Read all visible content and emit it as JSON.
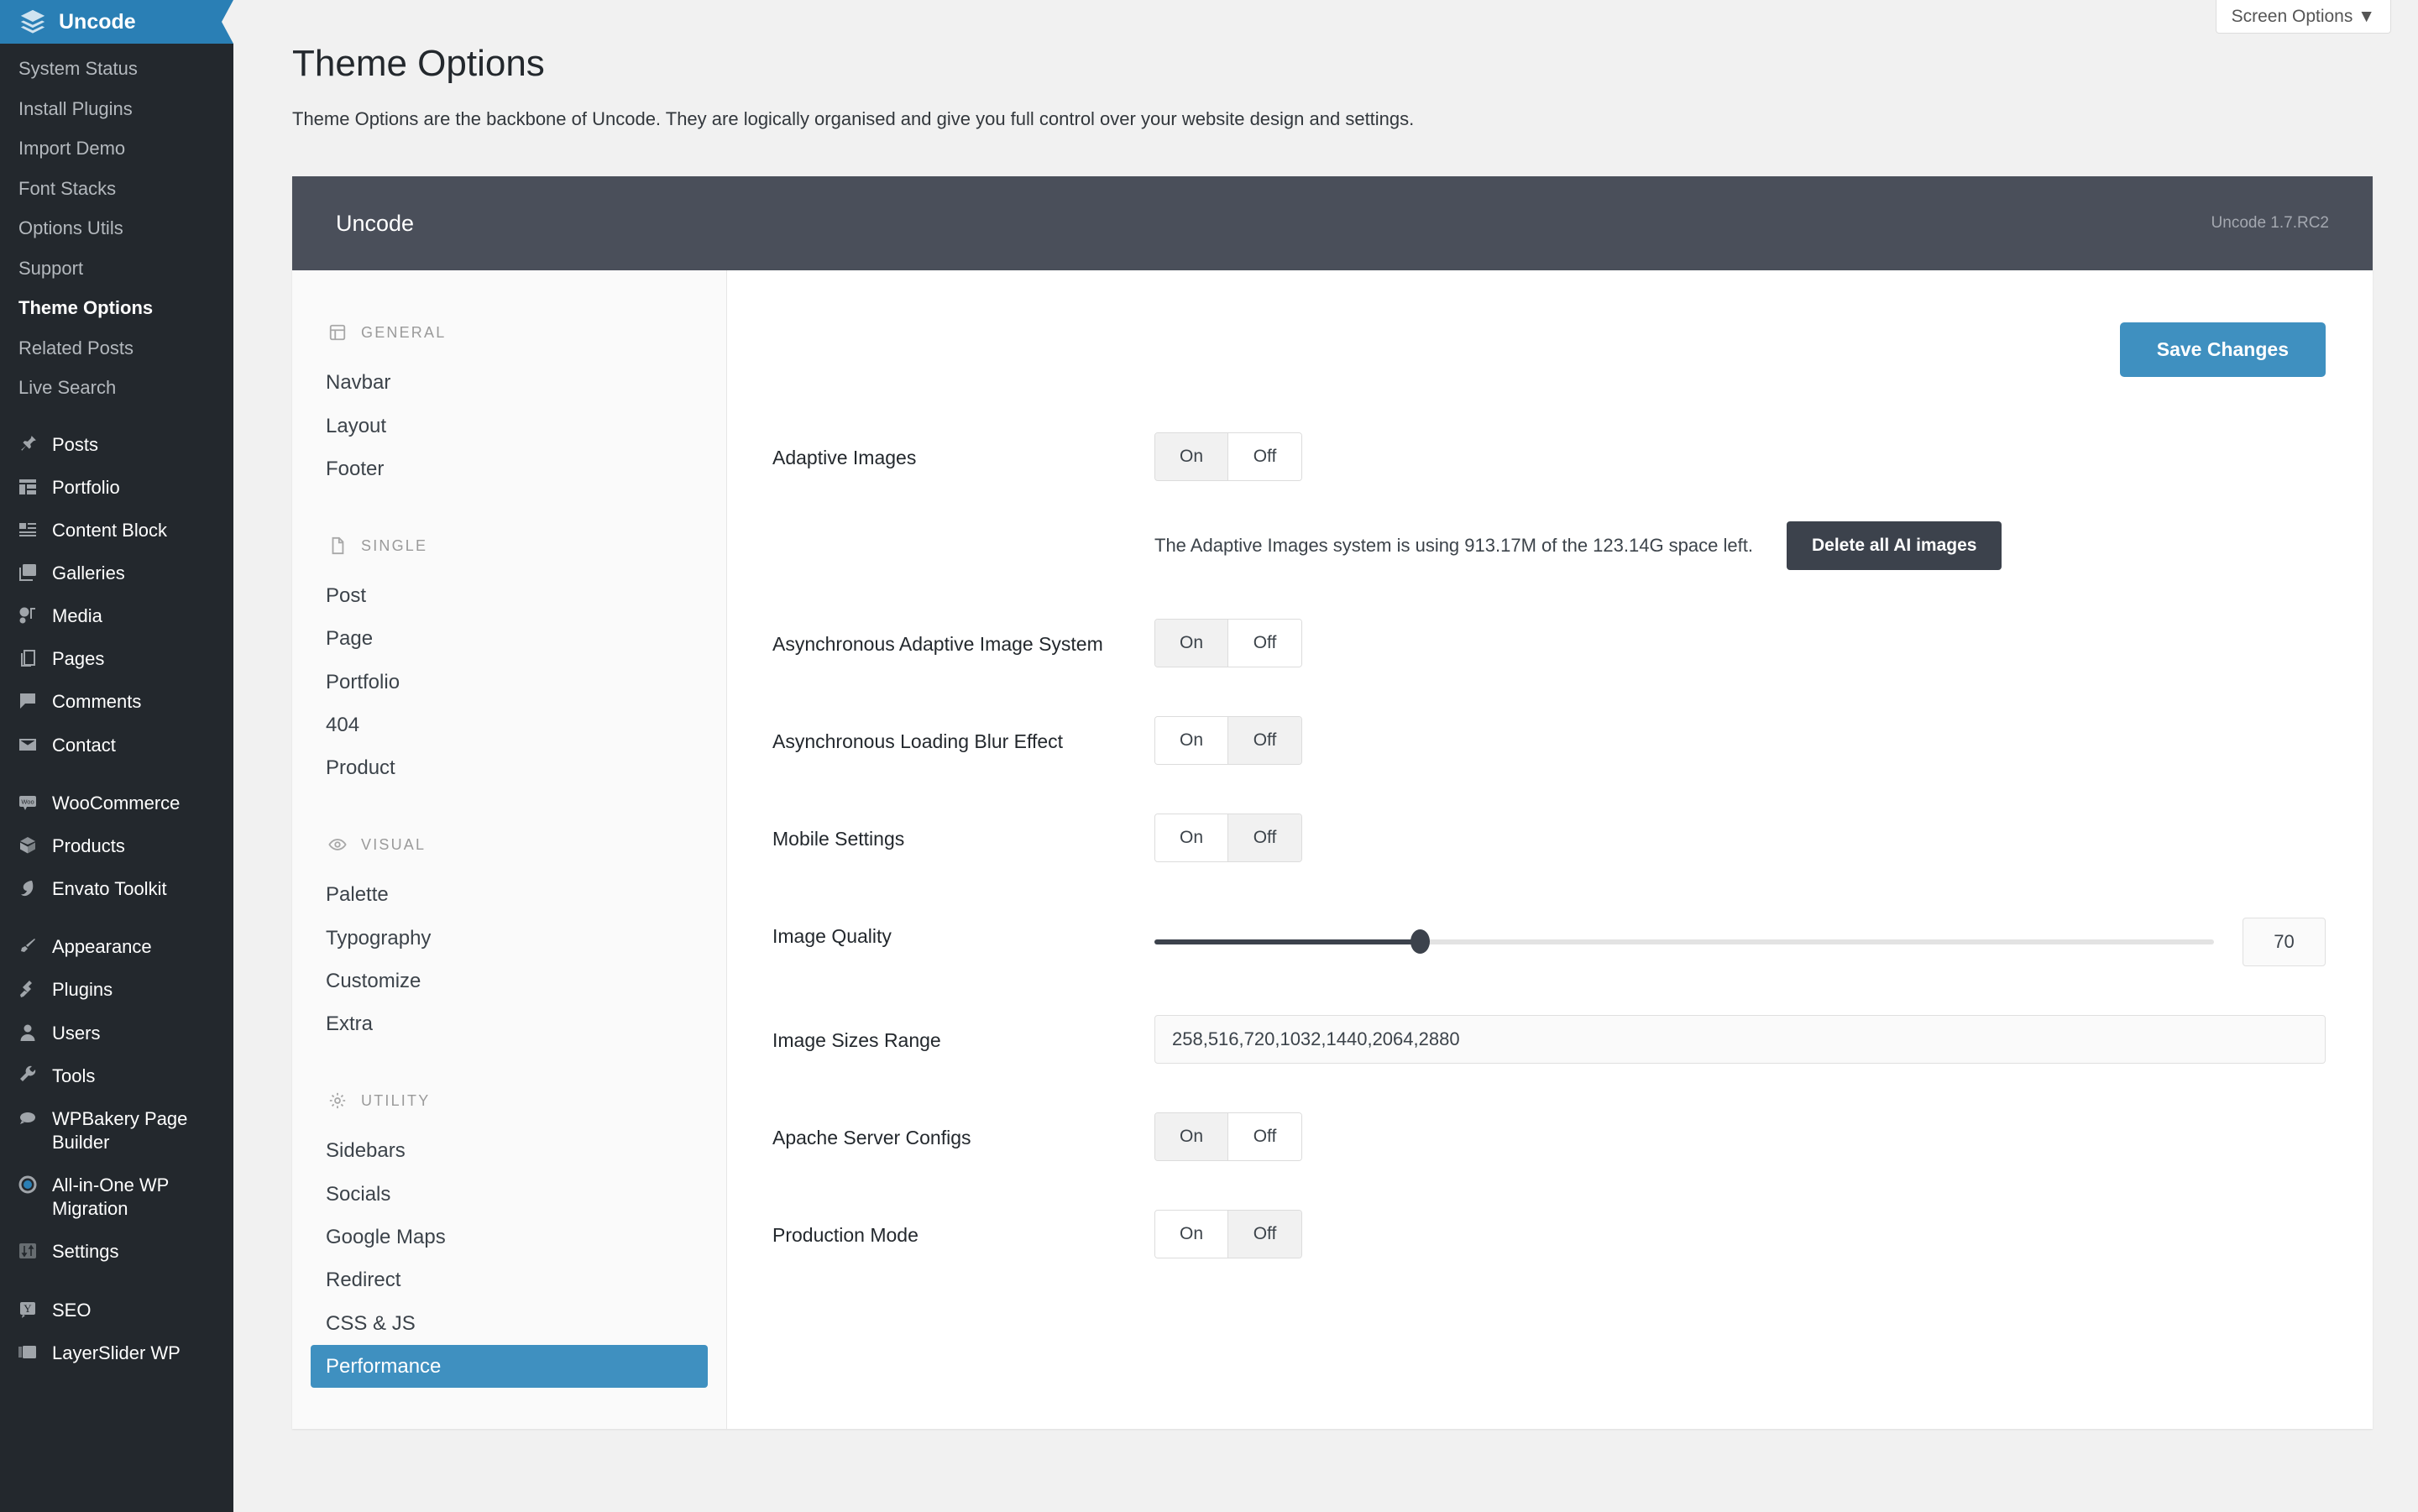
{
  "wp_sidebar": {
    "brand": {
      "label": "Uncode",
      "icon": "layers-icon"
    },
    "sub_items": [
      {
        "label": "System Status",
        "active": false
      },
      {
        "label": "Install Plugins",
        "active": false
      },
      {
        "label": "Import Demo",
        "active": false
      },
      {
        "label": "Font Stacks",
        "active": false
      },
      {
        "label": "Options Utils",
        "active": false
      },
      {
        "label": "Support",
        "active": false
      },
      {
        "label": "Theme Options",
        "active": true
      },
      {
        "label": "Related Posts",
        "active": false
      },
      {
        "label": "Live Search",
        "active": false
      }
    ],
    "groups": [
      {
        "items": [
          {
            "label": "Posts",
            "icon": "pin-icon"
          },
          {
            "label": "Portfolio",
            "icon": "portfolio-grid-icon"
          },
          {
            "label": "Content Block",
            "icon": "content-block-icon"
          },
          {
            "label": "Galleries",
            "icon": "galleries-icon"
          },
          {
            "label": "Media",
            "icon": "media-icon"
          },
          {
            "label": "Pages",
            "icon": "pages-icon"
          },
          {
            "label": "Comments",
            "icon": "comment-icon"
          },
          {
            "label": "Contact",
            "icon": "envelope-icon"
          }
        ]
      },
      {
        "items": [
          {
            "label": "WooCommerce",
            "icon": "woocommerce-icon"
          },
          {
            "label": "Products",
            "icon": "box-icon"
          },
          {
            "label": "Envato Toolkit",
            "icon": "envato-leaf-icon"
          }
        ]
      },
      {
        "items": [
          {
            "label": "Appearance",
            "icon": "paintbrush-icon"
          },
          {
            "label": "Plugins",
            "icon": "plug-icon"
          },
          {
            "label": "Users",
            "icon": "user-icon"
          },
          {
            "label": "Tools",
            "icon": "wrench-icon"
          },
          {
            "label": "WPBakery Page Builder",
            "icon": "wpbakery-icon"
          },
          {
            "label": "All-in-One WP Migration",
            "icon": "migration-circle-icon"
          },
          {
            "label": "Settings",
            "icon": "sliders-icon"
          }
        ]
      },
      {
        "items": [
          {
            "label": "SEO",
            "icon": "yoast-seo-icon"
          },
          {
            "label": "LayerSlider WP",
            "icon": "layerslider-icon"
          }
        ]
      }
    ]
  },
  "screen_options": {
    "label": "Screen Options",
    "caret": "▼"
  },
  "page": {
    "title": "Theme Options",
    "description": "Theme Options are the backbone of Uncode. They are logically organised and give you full control over your website design and settings."
  },
  "panel": {
    "title": "Uncode",
    "version": "Uncode 1.7.RC2"
  },
  "opt_nav": {
    "groups": [
      {
        "name": "GENERAL",
        "icon": "layout-panel-icon",
        "items": [
          {
            "label": "Navbar",
            "selected": false
          },
          {
            "label": "Layout",
            "selected": false
          },
          {
            "label": "Footer",
            "selected": false
          }
        ]
      },
      {
        "name": "SINGLE",
        "icon": "document-icon",
        "items": [
          {
            "label": "Post",
            "selected": false
          },
          {
            "label": "Page",
            "selected": false
          },
          {
            "label": "Portfolio",
            "selected": false
          },
          {
            "label": "404",
            "selected": false
          },
          {
            "label": "Product",
            "selected": false
          }
        ]
      },
      {
        "name": "VISUAL",
        "icon": "eye-icon",
        "items": [
          {
            "label": "Palette",
            "selected": false
          },
          {
            "label": "Typography",
            "selected": false
          },
          {
            "label": "Customize",
            "selected": false
          },
          {
            "label": "Extra",
            "selected": false
          }
        ]
      },
      {
        "name": "UTILITY",
        "icon": "gear-icon",
        "items": [
          {
            "label": "Sidebars",
            "selected": false
          },
          {
            "label": "Socials",
            "selected": false
          },
          {
            "label": "Google Maps",
            "selected": false
          },
          {
            "label": "Redirect",
            "selected": false
          },
          {
            "label": "CSS & JS",
            "selected": false
          },
          {
            "label": "Performance",
            "selected": true
          }
        ]
      }
    ]
  },
  "form": {
    "save_label": "Save Changes",
    "toggle_on": "On",
    "toggle_off": "Off",
    "adaptive_images": {
      "label": "Adaptive Images",
      "value": "On"
    },
    "adaptive_note": "The Adaptive Images system is using 913.17M of the 123.14G space left.",
    "delete_label": "Delete all AI images",
    "async_adaptive": {
      "label": "Asynchronous Adaptive Image System",
      "value": "On"
    },
    "async_blur": {
      "label": "Asynchronous Loading Blur Effect",
      "value": "Off"
    },
    "mobile_settings": {
      "label": "Mobile Settings",
      "value": "Off"
    },
    "image_quality": {
      "label": "Image Quality",
      "value": "70",
      "percent": 25
    },
    "image_sizes": {
      "label": "Image Sizes Range",
      "value": "258,516,720,1032,1440,2064,2880"
    },
    "apache_configs": {
      "label": "Apache Server Configs",
      "value": "On"
    },
    "production_mode": {
      "label": "Production Mode",
      "value": "Off"
    }
  },
  "colors": {
    "accent_blue": "#3f90c0",
    "sidebar_bg": "#23282d",
    "panel_head": "#4a4f5a",
    "dark_button": "#3c424c"
  }
}
